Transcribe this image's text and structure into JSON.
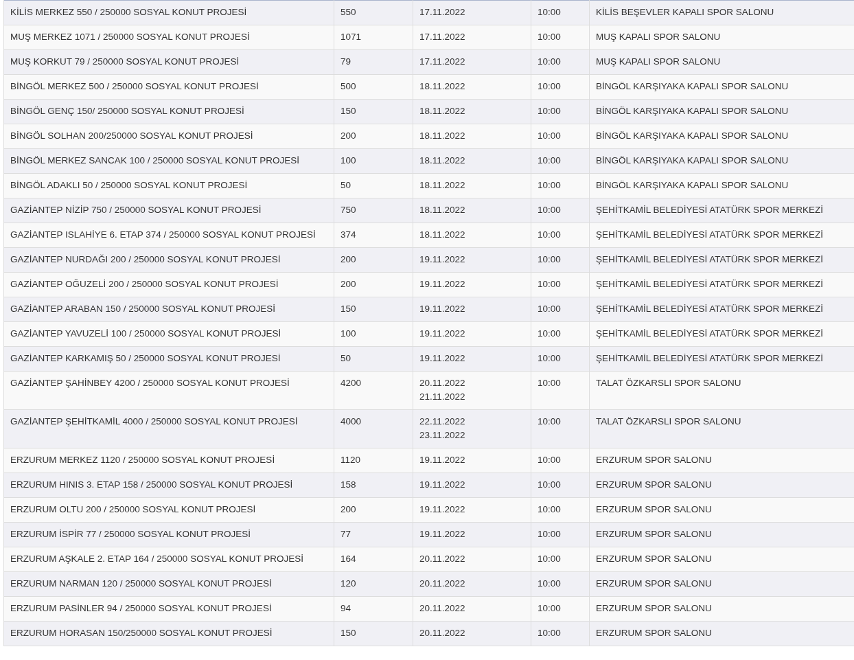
{
  "table": {
    "rows": [
      {
        "project": "KİLİS MERKEZ 550 / 250000 SOSYAL KONUT PROJESİ",
        "count": "550",
        "dates": [
          "17.11.2022"
        ],
        "time": "10:00",
        "venue": "KİLİS BEŞEVLER KAPALI SPOR SALONU"
      },
      {
        "project": "MUŞ MERKEZ 1071 / 250000 SOSYAL KONUT PROJESİ",
        "count": "1071",
        "dates": [
          "17.11.2022"
        ],
        "time": "10:00",
        "venue": "MUŞ KAPALI SPOR SALONU"
      },
      {
        "project": "MUŞ KORKUT 79 / 250000 SOSYAL KONUT PROJESİ",
        "count": "79",
        "dates": [
          "17.11.2022"
        ],
        "time": "10:00",
        "venue": "MUŞ KAPALI SPOR SALONU"
      },
      {
        "project": "BİNGÖL MERKEZ 500 / 250000 SOSYAL KONUT PROJESİ",
        "count": "500",
        "dates": [
          "18.11.2022"
        ],
        "time": "10:00",
        "venue": "BİNGÖL KARŞIYAKA KAPALI SPOR SALONU"
      },
      {
        "project": "BİNGÖL GENÇ 150/ 250000 SOSYAL KONUT PROJESİ",
        "count": "150",
        "dates": [
          "18.11.2022"
        ],
        "time": "10:00",
        "venue": "BİNGÖL KARŞIYAKA KAPALI SPOR SALONU"
      },
      {
        "project": "BİNGÖL SOLHAN 200/250000 SOSYAL KONUT PROJESİ",
        "count": "200",
        "dates": [
          "18.11.2022"
        ],
        "time": "10:00",
        "venue": "BİNGÖL KARŞIYAKA KAPALI SPOR SALONU"
      },
      {
        "project": "BİNGÖL MERKEZ SANCAK 100 / 250000 SOSYAL KONUT PROJESİ",
        "count": "100",
        "dates": [
          "18.11.2022"
        ],
        "time": "10:00",
        "venue": "BİNGÖL KARŞIYAKA KAPALI SPOR SALONU"
      },
      {
        "project": "BİNGÖL ADAKLI 50 / 250000 SOSYAL KONUT PROJESİ",
        "count": "50",
        "dates": [
          "18.11.2022"
        ],
        "time": "10:00",
        "venue": "BİNGÖL KARŞIYAKA KAPALI SPOR SALONU"
      },
      {
        "project": "GAZİANTEP NİZİP 750 / 250000 SOSYAL KONUT PROJESİ",
        "count": "750",
        "dates": [
          "18.11.2022"
        ],
        "time": "10:00",
        "venue": "ŞEHİTKAMİL BELEDİYESİ ATATÜRK SPOR MERKEZİ"
      },
      {
        "project": "GAZİANTEP ISLAHİYE 6. ETAP 374 / 250000 SOSYAL KONUT PROJESİ",
        "count": "374",
        "dates": [
          "18.11.2022"
        ],
        "time": "10:00",
        "venue": "ŞEHİTKAMİL BELEDİYESİ ATATÜRK SPOR MERKEZİ"
      },
      {
        "project": "GAZİANTEP NURDAĞI 200 / 250000 SOSYAL KONUT PROJESİ",
        "count": "200",
        "dates": [
          "19.11.2022"
        ],
        "time": "10:00",
        "venue": "ŞEHİTKAMİL BELEDİYESİ ATATÜRK SPOR MERKEZİ"
      },
      {
        "project": "GAZİANTEP OĞUZELİ 200 / 250000 SOSYAL KONUT PROJESİ",
        "count": "200",
        "dates": [
          "19.11.2022"
        ],
        "time": "10:00",
        "venue": "ŞEHİTKAMİL BELEDİYESİ ATATÜRK SPOR MERKEZİ"
      },
      {
        "project": "GAZİANTEP ARABAN 150 / 250000 SOSYAL KONUT PROJESİ",
        "count": "150",
        "dates": [
          "19.11.2022"
        ],
        "time": "10:00",
        "venue": "ŞEHİTKAMİL BELEDİYESİ ATATÜRK SPOR MERKEZİ"
      },
      {
        "project": "GAZİANTEP YAVUZELİ 100 / 250000 SOSYAL KONUT PROJESİ",
        "count": "100",
        "dates": [
          "19.11.2022"
        ],
        "time": "10:00",
        "venue": "ŞEHİTKAMİL BELEDİYESİ ATATÜRK SPOR MERKEZİ"
      },
      {
        "project": "GAZİANTEP KARKAMIŞ 50 / 250000 SOSYAL KONUT PROJESİ",
        "count": "50",
        "dates": [
          "19.11.2022"
        ],
        "time": "10:00",
        "venue": "ŞEHİTKAMİL BELEDİYESİ ATATÜRK SPOR MERKEZİ"
      },
      {
        "project": "GAZİANTEP ŞAHİNBEY 4200 / 250000 SOSYAL KONUT PROJESİ",
        "count": "4200",
        "dates": [
          "20.11.2022",
          "21.11.2022"
        ],
        "time": "10:00",
        "venue": "TALAT ÖZKARSLI SPOR SALONU"
      },
      {
        "project": "GAZİANTEP ŞEHİTKAMİL 4000 / 250000 SOSYAL KONUT PROJESİ",
        "count": "4000",
        "dates": [
          "22.11.2022",
          "23.11.2022"
        ],
        "time": "10:00",
        "venue": "TALAT ÖZKARSLI SPOR SALONU"
      },
      {
        "project": "ERZURUM MERKEZ 1120 / 250000 SOSYAL KONUT PROJESİ",
        "count": "1120",
        "dates": [
          "19.11.2022"
        ],
        "time": "10:00",
        "venue": "ERZURUM SPOR SALONU"
      },
      {
        "project": "ERZURUM HINIS 3. ETAP 158 / 250000 SOSYAL KONUT PROJESİ",
        "count": "158",
        "dates": [
          "19.11.2022"
        ],
        "time": "10:00",
        "venue": "ERZURUM SPOR SALONU"
      },
      {
        "project": "ERZURUM OLTU 200 / 250000 SOSYAL KONUT PROJESİ",
        "count": "200",
        "dates": [
          "19.11.2022"
        ],
        "time": "10:00",
        "venue": "ERZURUM SPOR SALONU"
      },
      {
        "project": "ERZURUM İSPİR 77 / 250000 SOSYAL KONUT PROJESİ",
        "count": "77",
        "dates": [
          "19.11.2022"
        ],
        "time": "10:00",
        "venue": "ERZURUM SPOR SALONU"
      },
      {
        "project": "ERZURUM AŞKALE 2. ETAP 164 / 250000 SOSYAL KONUT PROJESİ",
        "count": "164",
        "dates": [
          "20.11.2022"
        ],
        "time": "10:00",
        "venue": "ERZURUM SPOR SALONU"
      },
      {
        "project": "ERZURUM NARMAN 120 / 250000 SOSYAL KONUT PROJESİ",
        "count": "120",
        "dates": [
          "20.11.2022"
        ],
        "time": "10:00",
        "venue": "ERZURUM SPOR SALONU"
      },
      {
        "project": "ERZURUM PASİNLER 94 / 250000 SOSYAL KONUT PROJESİ",
        "count": "94",
        "dates": [
          "20.11.2022"
        ],
        "time": "10:00",
        "venue": "ERZURUM SPOR SALONU"
      },
      {
        "project": "ERZURUM HORASAN 150/250000 SOSYAL KONUT PROJESİ",
        "count": "150",
        "dates": [
          "20.11.2022"
        ],
        "time": "10:00",
        "venue": "ERZURUM SPOR SALONU"
      }
    ]
  }
}
